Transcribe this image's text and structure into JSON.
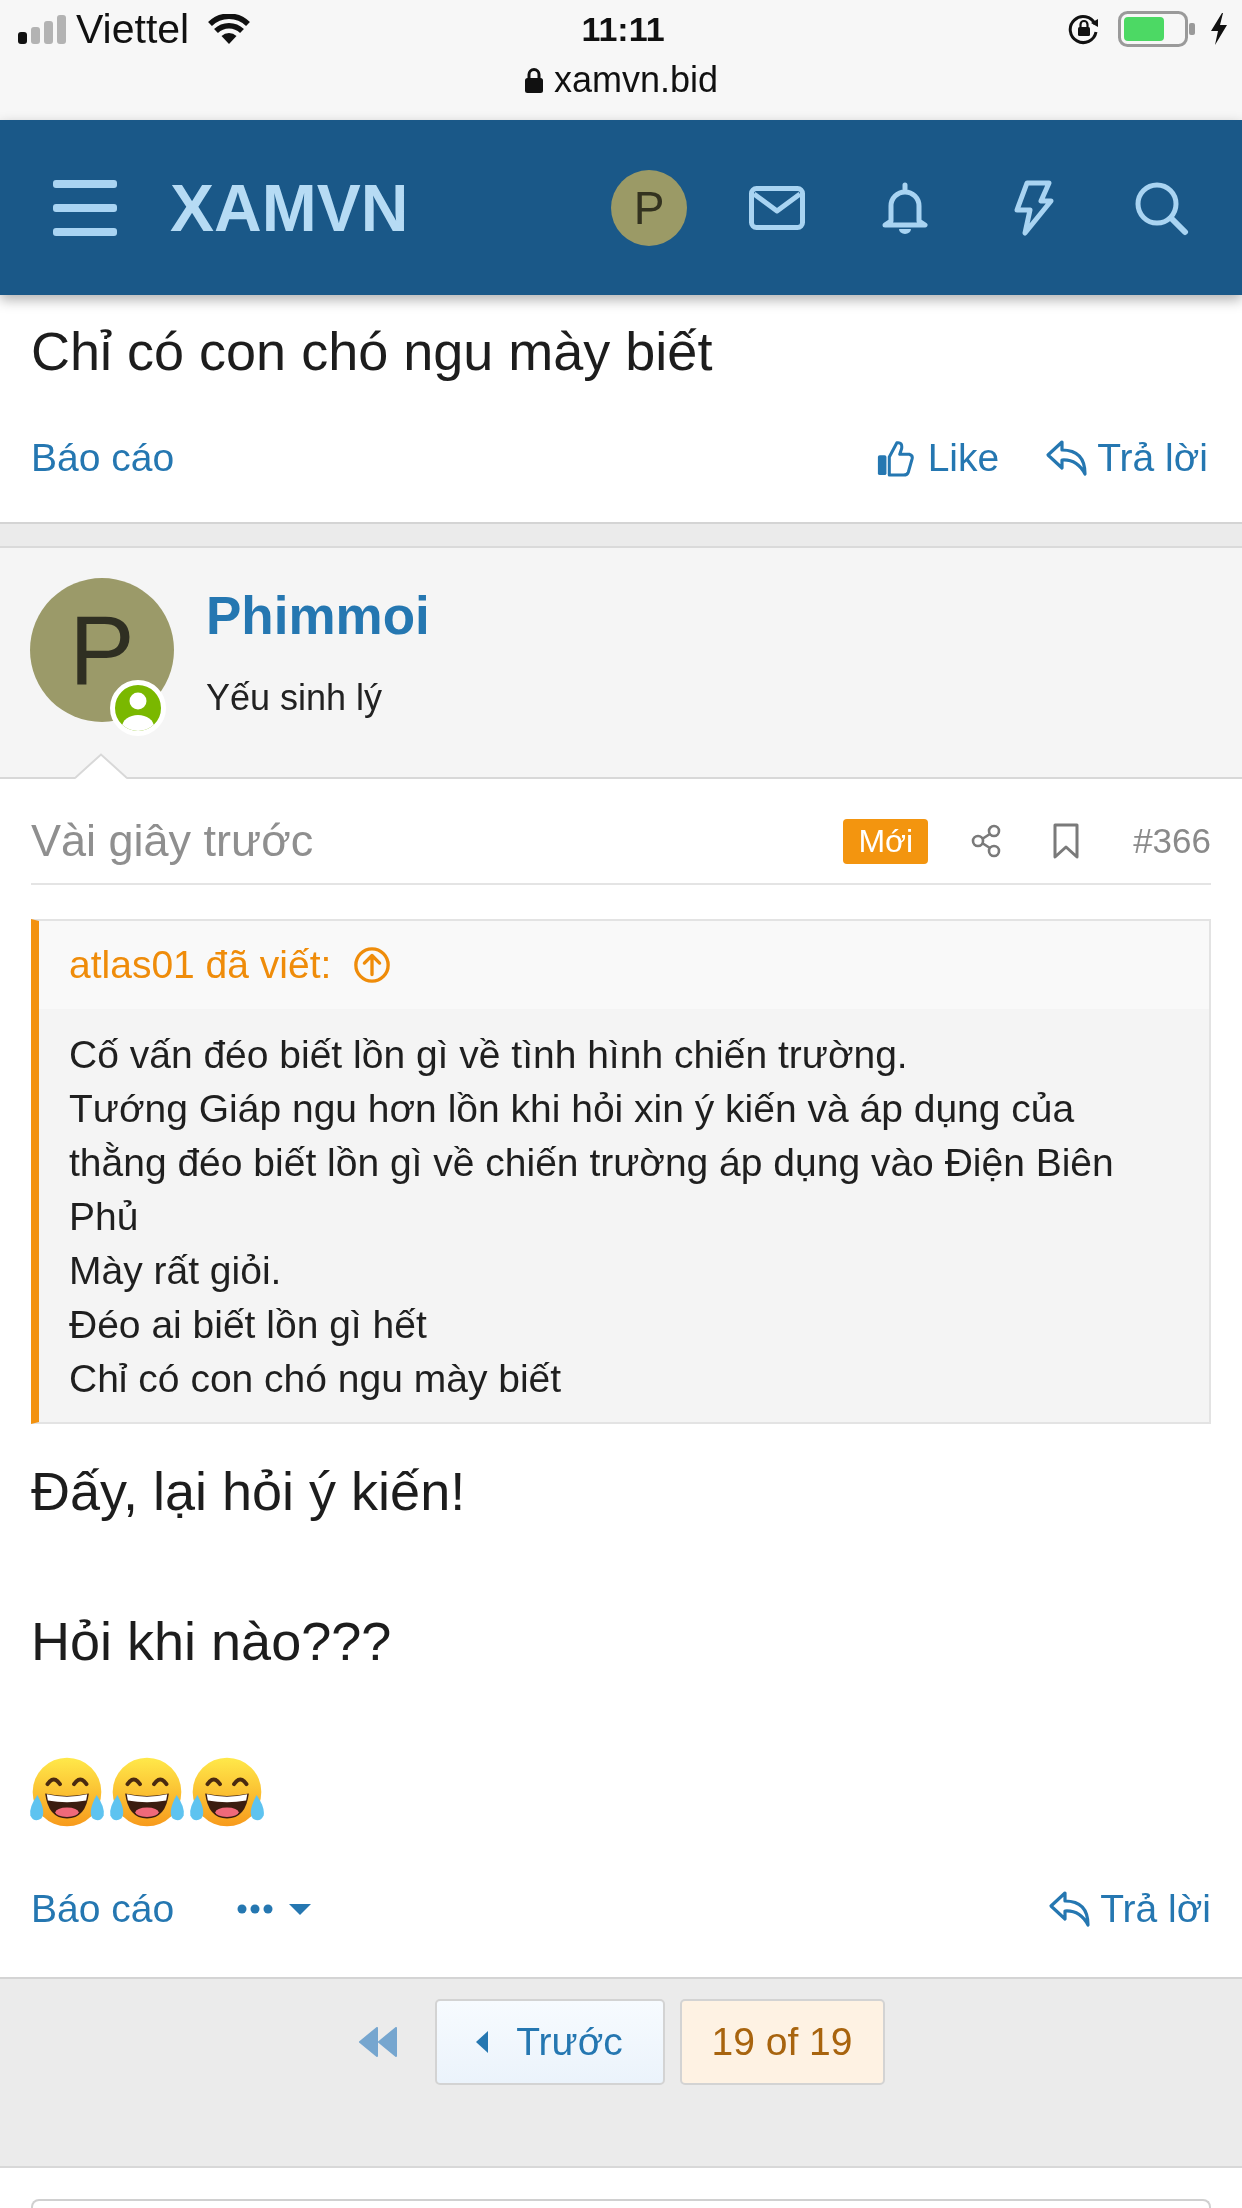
{
  "status_bar": {
    "carrier": "Viettel",
    "time": "11:11",
    "url": "xamvn.bid"
  },
  "header": {
    "logo": "XAMVN",
    "avatar_letter": "P"
  },
  "previous_post": {
    "text": "Chỉ có con chó ngu mày biết",
    "actions": [
      {
        "kind": "report",
        "label": "Báo cáo"
      },
      {
        "kind": "like",
        "label": "Like"
      },
      {
        "kind": "reply",
        "label": "Trả lời"
      }
    ]
  },
  "post": {
    "author": {
      "avatar_letter": "P",
      "name": "Phimmoi",
      "title": "Yếu sinh lý",
      "online": true
    },
    "time": "Vài giây trước",
    "badge": "Mới",
    "number": "#366",
    "quote": {
      "attribution": "atlas01 đã viết:",
      "lines": [
        "Cố vấn đéo biết lồn gì về tình hình chiến trường.",
        "Tướng Giáp ngu hơn lồn khi hỏi xin ý kiến và áp dụng của thằng đéo biết lồn gì về chiến trường áp dụng vào Điện Biên Phủ",
        "Mày rất giỏi.",
        "Đéo ai biết lồn gì hết",
        "Chỉ có con chó ngu mày biết"
      ]
    },
    "paragraphs": [
      "Đấy, lại hỏi ý kiến!",
      "Hỏi khi nào???"
    ],
    "emojis": [
      {
        "kind": "tears_of_joy"
      },
      {
        "kind": "tears_of_joy"
      },
      {
        "kind": "tears_of_joy"
      }
    ],
    "actions": [
      {
        "kind": "report",
        "label": "Báo cáo"
      },
      {
        "kind": "more"
      },
      {
        "kind": "reply",
        "label": "Trả lời"
      }
    ]
  },
  "pagination": {
    "items": [
      {
        "kind": "first"
      },
      {
        "kind": "prev",
        "label": "Trước"
      },
      {
        "kind": "jump",
        "label": "19 of 19"
      }
    ]
  }
}
